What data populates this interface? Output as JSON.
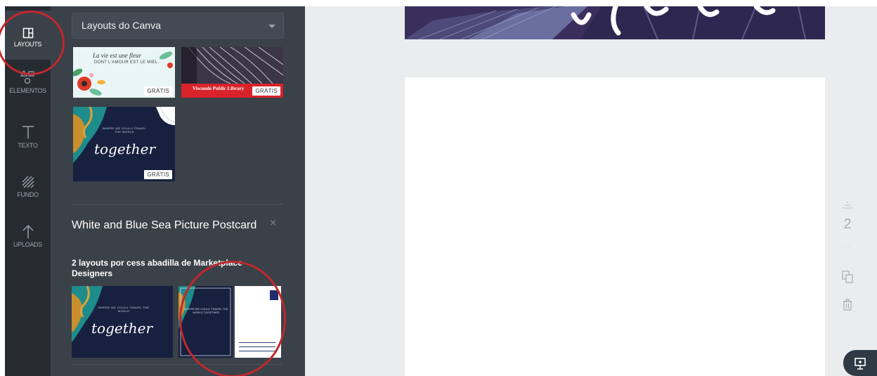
{
  "sidebar": {
    "items": [
      {
        "label": "LAYOUTS",
        "icon": "layouts-icon",
        "active": true
      },
      {
        "label": "ELEMENTOS",
        "icon": "elements-icon"
      },
      {
        "label": "TEXTO",
        "icon": "text-icon"
      },
      {
        "label": "FUNDO",
        "icon": "background-icon"
      },
      {
        "label": "UPLOADS",
        "icon": "upload-icon"
      }
    ]
  },
  "panel": {
    "dropdown": "Layouts do Canva",
    "thumbnails": [
      {
        "text_a": "La vie est une fleur",
        "text_b": "DONT L'AMOUR EST LE MIEL.",
        "badge": "GRÁTIS"
      },
      {
        "text_a": "Visconde Public Library",
        "badge": "GRÁTIS"
      },
      {
        "text_a": "WHERE WE COULD TRAVEL THE WORLD",
        "text_b": "together",
        "badge": "GRÁTIS"
      }
    ],
    "section": {
      "title": "White and Blue Sea Picture Postcard",
      "close": "×",
      "subtitle": "2 layouts por cess abadilla de Marketplace Designers",
      "previews": [
        {
          "text_a": "WHERE WE COULD TRAVEL THE WORLD",
          "text_b": "together"
        },
        {
          "text_a": "WHERE WE COULD TRAVEL THE WORLD TOGETHER"
        }
      ]
    }
  },
  "canvas": {
    "page_number": "2"
  },
  "colors": {
    "rail_bg": "#262b31",
    "panel_bg": "#3a4149",
    "workspace_bg": "#ebecee",
    "badge_red": "#d8232a",
    "annotation_red": "#c1272d",
    "postcard_navy": "#17203f"
  }
}
